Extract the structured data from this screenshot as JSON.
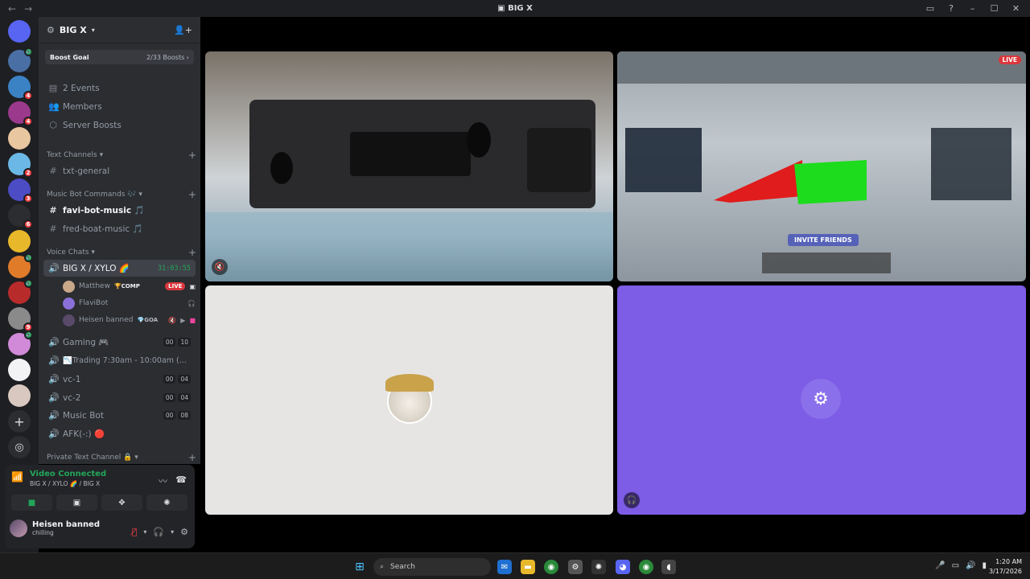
{
  "window": {
    "title": "BIG X",
    "back": "←",
    "forward": "→"
  },
  "servers": [
    {
      "badge": "",
      "vc": false,
      "color": "#5865f2"
    },
    {
      "badge": "",
      "vc": true,
      "color": "#4a6fa5"
    },
    {
      "badge": "4",
      "vc": false,
      "color": "#3b82c4"
    },
    {
      "badge": "4",
      "vc": false,
      "color": "#9b3a8c"
    },
    {
      "badge": "",
      "vc": false,
      "color": "#e8c6a0"
    },
    {
      "badge": "2",
      "vc": false,
      "color": "#6bb8e6"
    },
    {
      "badge": "3",
      "vc": false,
      "color": "#4c4cc4"
    },
    {
      "badge": "6",
      "vc": false,
      "color": "#2b2d31"
    },
    {
      "badge": "",
      "vc": false,
      "color": "#e8b82b"
    },
    {
      "badge": "",
      "vc": true,
      "color": "#e07b2a"
    },
    {
      "badge": "",
      "vc": true,
      "color": "#b82b2b"
    },
    {
      "badge": "9",
      "vc": false,
      "color": "#8a8a8a"
    },
    {
      "badge": "",
      "vc": true,
      "color": "#d08ad8"
    },
    {
      "badge": "",
      "vc": false,
      "color": "#f2f3f5"
    },
    {
      "badge": "",
      "vc": false,
      "color": "#d8c8c0"
    }
  ],
  "guild": {
    "name": "BIG X",
    "boost_label": "Boost Goal",
    "boost_count": "2/33 Boosts"
  },
  "shortcuts": [
    {
      "icon": "▤",
      "label": "2 Events"
    },
    {
      "icon": "👥",
      "label": "Members"
    },
    {
      "icon": "⬡",
      "label": "Server Boosts"
    }
  ],
  "categories": {
    "text": "Text Channels",
    "music": "Music Bot Commands 🎶",
    "voice": "Voice Chats",
    "private": "Private Text Channel 🔒"
  },
  "text_channels": [
    {
      "label": "txt-general"
    }
  ],
  "music_channels": [
    {
      "label": "favi-bot-music 🎵"
    },
    {
      "label": "fred-boat-music 🎵"
    }
  ],
  "voice_active": {
    "label": "BIG X / XYLO 🌈",
    "timer": "31:03:55"
  },
  "members": [
    {
      "name": "Matthew",
      "tag": "🏆COMP",
      "live": "LIVE"
    },
    {
      "name": "FlaviBot",
      "tag": "",
      "live": ""
    },
    {
      "name": "Heisen banned",
      "tag": "💎GOA",
      "live": ""
    }
  ],
  "voice_channels": [
    {
      "label": "Gaming 🎮",
      "a": "00",
      "b": "10"
    },
    {
      "label": "📉Trading 7:30am - 10:00am (...",
      "a": "",
      "b": ""
    },
    {
      "label": "vc-1",
      "a": "00",
      "b": "04"
    },
    {
      "label": "vc-2",
      "a": "00",
      "b": "04"
    },
    {
      "label": "Music Bot",
      "a": "00",
      "b": "08"
    },
    {
      "label": "AFK(-:) 🔴",
      "a": "",
      "b": ""
    }
  ],
  "voice_panel": {
    "status": "Video Connected",
    "location": "BIG X / XYLO 🌈 / BIG X",
    "user_name": "Heisen banned",
    "user_status": "chilling"
  },
  "tiles": {
    "game_live": "LIVE",
    "invite": "INVITE FRIENDS"
  },
  "taskbar": {
    "search": "Search",
    "time": "1:20 AM",
    "date": "3/17/2026"
  }
}
